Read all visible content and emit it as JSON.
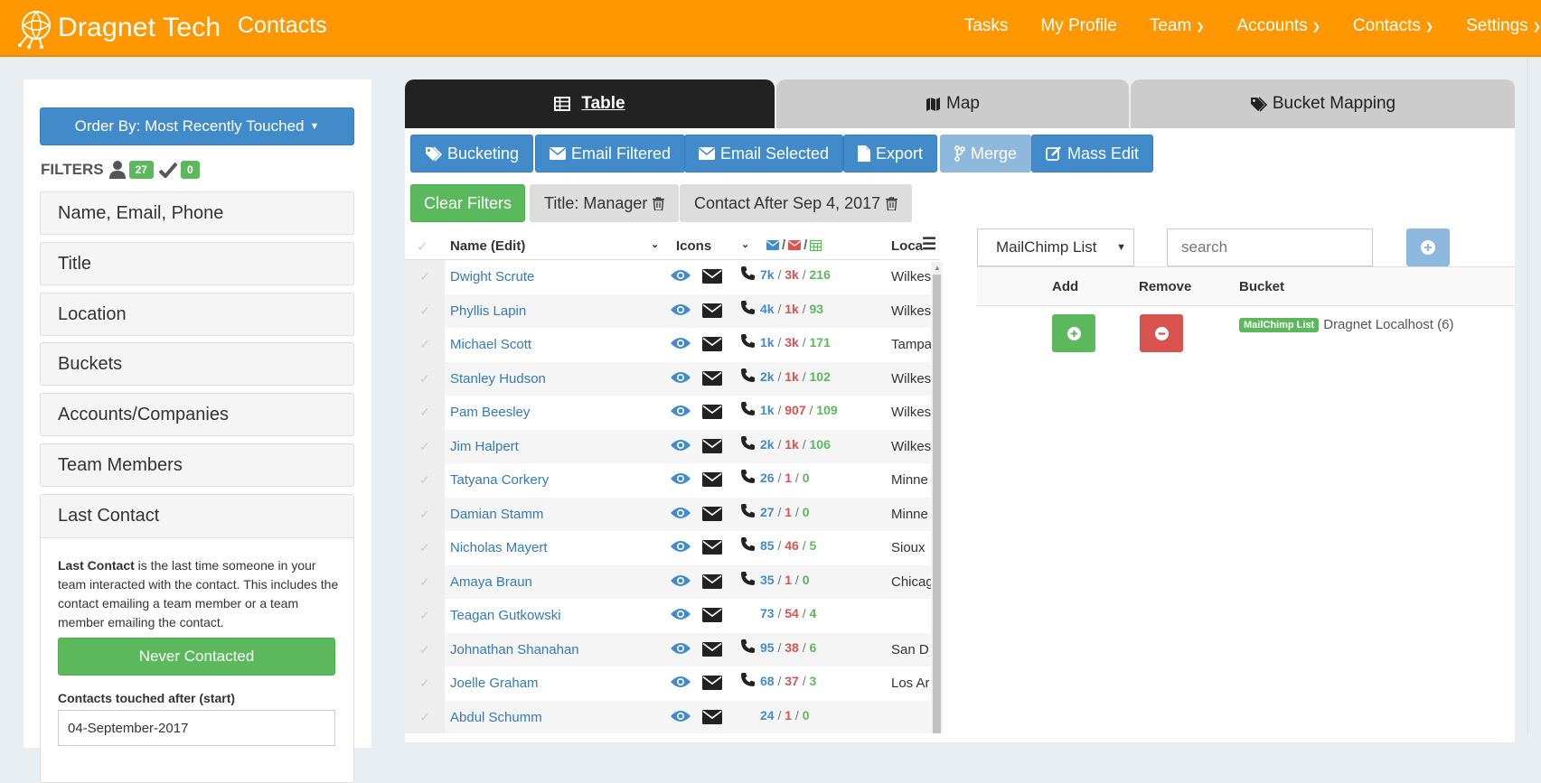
{
  "brand": {
    "name": "Dragnet Tech",
    "page_title": "Contacts"
  },
  "nav": [
    {
      "label": "Tasks",
      "dropdown": false
    },
    {
      "label": "My Profile",
      "dropdown": false
    },
    {
      "label": "Team",
      "dropdown": true
    },
    {
      "label": "Accounts",
      "dropdown": true
    },
    {
      "label": "Contacts",
      "dropdown": true
    },
    {
      "label": "Settings",
      "dropdown": true
    }
  ],
  "sidebar": {
    "order_by": "Order By: Most Recently Touched",
    "filters_label": "FILTERS",
    "user_count": "27",
    "check_count": "0",
    "sections": [
      "Name, Email, Phone",
      "Title",
      "Location",
      "Buckets",
      "Accounts/Companies",
      "Team Members"
    ],
    "last_contact": {
      "title": "Last Contact",
      "desc_bold": "Last Contact",
      "desc_rest": " is the last time someone in your team interacted with the contact. This includes the contact emailing a team member or a team member emailing the contact.",
      "never_button": "Never Contacted",
      "touched_after_label": "Contacts touched after (start)",
      "touched_after_value": "04-September-2017"
    }
  },
  "tabs": {
    "table": "Table",
    "map": "Map",
    "bucket": "Bucket Mapping"
  },
  "actions": {
    "bucketing": "Bucketing",
    "email_filtered": "Email Filtered",
    "email_selected": "Email Selected",
    "export": "Export",
    "merge": "Merge",
    "mass_edit": "Mass Edit"
  },
  "active_filters": {
    "clear": "Clear Filters",
    "chips": [
      "Title: Manager",
      "Contact After Sep 4, 2017"
    ]
  },
  "table": {
    "headers": {
      "name": "Name (Edit)",
      "icons": "Icons",
      "location": "Loca"
    },
    "rows": [
      {
        "name": "Dwight Scrute",
        "phone": true,
        "a": "7k",
        "b": "3k",
        "c": "216",
        "loc": "Wilkes"
      },
      {
        "name": "Phyllis Lapin",
        "phone": true,
        "a": "4k",
        "b": "1k",
        "c": "93",
        "loc": "Wilkes"
      },
      {
        "name": "Michael Scott",
        "phone": true,
        "a": "1k",
        "b": "3k",
        "c": "171",
        "loc": "Tampa"
      },
      {
        "name": "Stanley Hudson",
        "phone": true,
        "a": "2k",
        "b": "1k",
        "c": "102",
        "loc": "Wilkes"
      },
      {
        "name": "Pam Beesley",
        "phone": true,
        "a": "1k",
        "b": "907",
        "c": "109",
        "loc": "Wilkes"
      },
      {
        "name": "Jim Halpert",
        "phone": true,
        "a": "2k",
        "b": "1k",
        "c": "106",
        "loc": "Wilkes"
      },
      {
        "name": "Tatyana Corkery",
        "phone": true,
        "a": "26",
        "b": "1",
        "c": "0",
        "loc": "Minne"
      },
      {
        "name": "Damian Stamm",
        "phone": true,
        "a": "27",
        "b": "1",
        "c": "0",
        "loc": "Minne"
      },
      {
        "name": "Nicholas Mayert",
        "phone": true,
        "a": "85",
        "b": "46",
        "c": "5",
        "loc": "Sioux"
      },
      {
        "name": "Amaya Braun",
        "phone": true,
        "a": "35",
        "b": "1",
        "c": "0",
        "loc": "Chicag"
      },
      {
        "name": "Teagan Gutkowski",
        "phone": false,
        "a": "73",
        "b": "54",
        "c": "4",
        "loc": ""
      },
      {
        "name": "Johnathan Shanahan",
        "phone": true,
        "a": "95",
        "b": "38",
        "c": "6",
        "loc": "San D"
      },
      {
        "name": "Joelle Graham",
        "phone": true,
        "a": "68",
        "b": "37",
        "c": "3",
        "loc": "Los Ar"
      },
      {
        "name": "Abdul Schumm",
        "phone": false,
        "a": "24",
        "b": "1",
        "c": "0",
        "loc": ""
      }
    ]
  },
  "bucket_panel": {
    "select_value": "MailChimp List",
    "search_placeholder": "search",
    "headers": {
      "add": "Add",
      "remove": "Remove",
      "bucket": "Bucket"
    },
    "row": {
      "label": "MailChimp List",
      "name": "Dragnet Localhost (6)"
    }
  },
  "colors": {
    "nav": "#ff9800",
    "primary": "#428bca",
    "success": "#5cb85c",
    "danger": "#d9534f"
  }
}
